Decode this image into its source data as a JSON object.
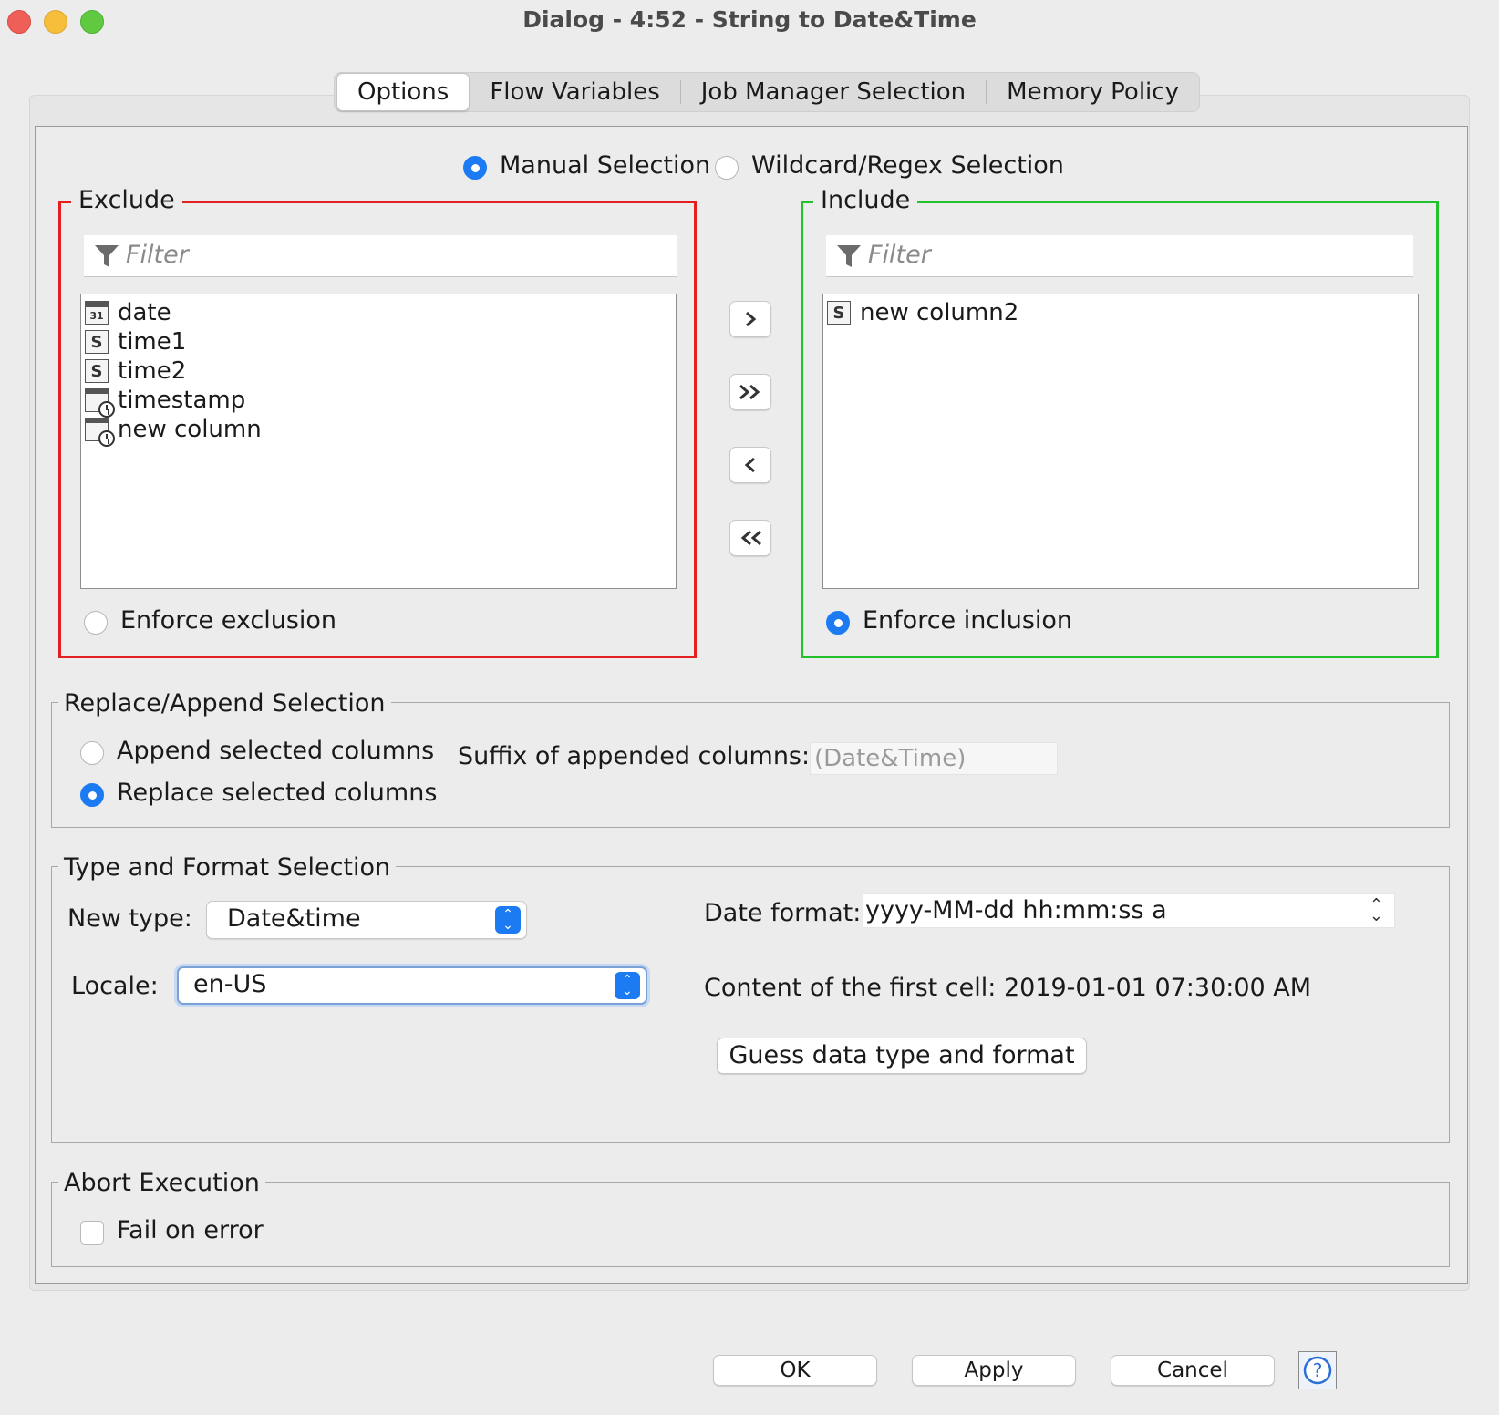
{
  "window": {
    "title": "Dialog - 4:52 - String to Date&Time"
  },
  "tabs": [
    "Options",
    "Flow Variables",
    "Job Manager Selection",
    "Memory Policy"
  ],
  "selection_mode": {
    "manual": "Manual Selection",
    "wildcard": "Wildcard/Regex Selection",
    "selected": "manual"
  },
  "exclude": {
    "title": "Exclude",
    "filter_placeholder": "Filter",
    "columns": [
      {
        "name": "date",
        "type": "date-icon"
      },
      {
        "name": "time1",
        "type": "string-icon"
      },
      {
        "name": "time2",
        "type": "string-icon"
      },
      {
        "name": "timestamp",
        "type": "datetime-icon"
      },
      {
        "name": "new column",
        "type": "datetime-icon"
      }
    ],
    "enforce_label": "Enforce exclusion"
  },
  "include": {
    "title": "Include",
    "filter_placeholder": "Filter",
    "columns": [
      {
        "name": "new column2",
        "type": "string-icon"
      }
    ],
    "enforce_label": "Enforce inclusion"
  },
  "move_buttons": [
    ">",
    "»",
    "<",
    "«"
  ],
  "replace_append": {
    "title": "Replace/Append Selection",
    "append_label": "Append selected columns",
    "replace_label": "Replace selected columns",
    "selected": "replace",
    "suffix_label": "Suffix of appended columns:",
    "suffix_value": "(Date&Time)"
  },
  "type_format": {
    "title": "Type and Format Selection",
    "new_type_label": "New type:",
    "new_type_value": "Date&time",
    "locale_label": "Locale:",
    "locale_value": "en-US",
    "date_format_label": "Date format:",
    "date_format_value": "yyyy-MM-dd hh:mm:ss a",
    "first_cell_text": "Content of the first cell: 2019-01-01 07:30:00 AM",
    "guess_button": "Guess data type and format"
  },
  "abort": {
    "title": "Abort Execution",
    "fail_label": "Fail on error",
    "checked": false
  },
  "footer": {
    "ok": "OK",
    "apply": "Apply",
    "cancel": "Cancel",
    "help": "?"
  },
  "colors": {
    "accent": "#1c7bf2",
    "exclude_border": "#e32020",
    "include_border": "#22c22c"
  }
}
